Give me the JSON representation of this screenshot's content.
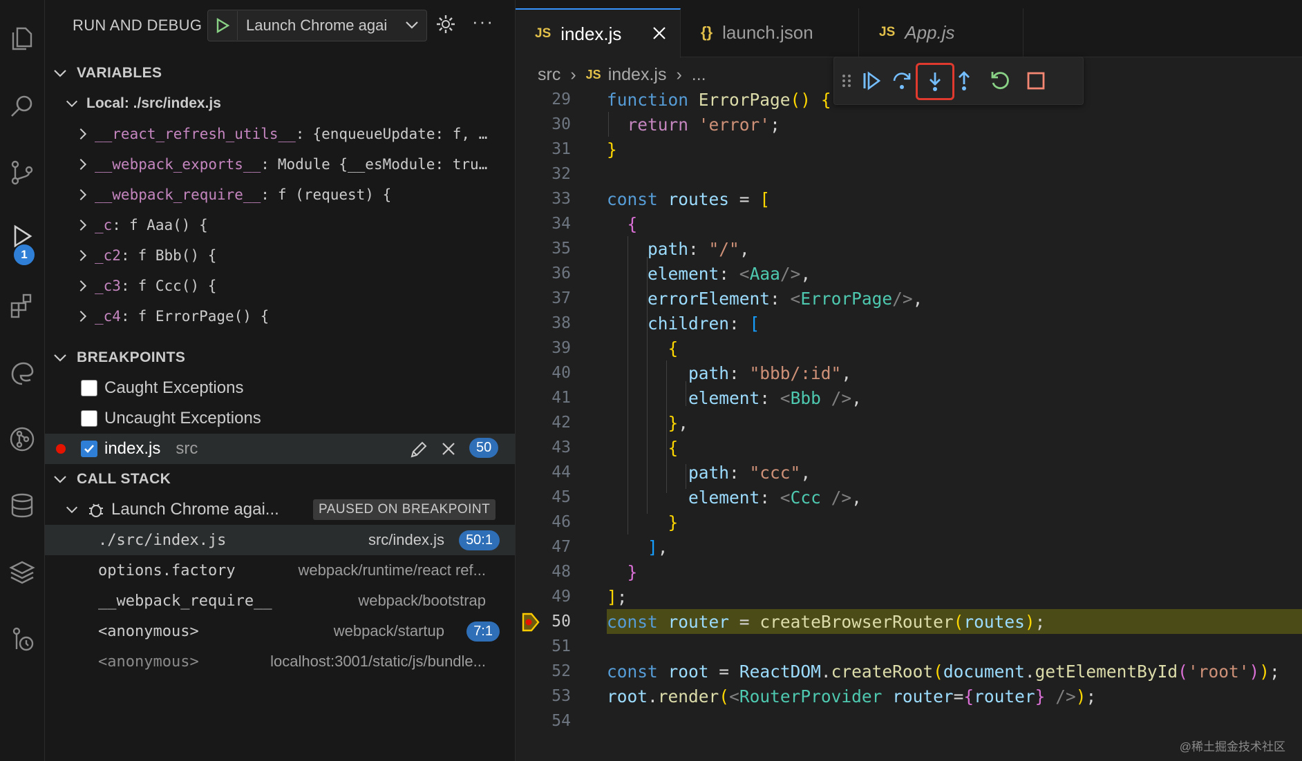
{
  "sidebar": {
    "title": "RUN AND DEBUG",
    "launch_config": "Launch Chrome agai",
    "sections": {
      "variables": "VARIABLES",
      "breakpoints": "BREAKPOINTS",
      "call_stack": "CALL STACK"
    },
    "local_scope": "Local: ./src/index.js",
    "variables": [
      {
        "name": "__react_refresh_utils__",
        "value": "{enqueueUpdate: f, …"
      },
      {
        "name": "__webpack_exports__",
        "value": "Module {__esModule: tru…"
      },
      {
        "name": "__webpack_require__",
        "value": "f (request) {"
      },
      {
        "name": "_c",
        "value": "f Aaa() {"
      },
      {
        "name": "_c2",
        "value": "f Bbb() {"
      },
      {
        "name": "_c3",
        "value": "f Ccc() {"
      },
      {
        "name": "_c4",
        "value": "f ErrorPage() {"
      }
    ],
    "breakpoints": {
      "caught": "Caught Exceptions",
      "uncaught": "Uncaught Exceptions",
      "file": "index.js",
      "folder": "src",
      "line": "50"
    },
    "call_stack": {
      "session": "Launch Chrome agai...",
      "status": "PAUSED ON BREAKPOINT",
      "frames": [
        {
          "name": "./src/index.js",
          "source": "src/index.js",
          "pos": "50:1"
        },
        {
          "name": "options.factory",
          "source": "webpack/runtime/react ref...",
          "pos": ""
        },
        {
          "name": "__webpack_require__",
          "source": "webpack/bootstrap",
          "pos": ""
        },
        {
          "name": "<anonymous>",
          "source": "webpack/startup",
          "pos": "7:1"
        },
        {
          "name": "<anonymous>",
          "source": "localhost:3001/static/js/bundle...",
          "pos": ""
        }
      ]
    }
  },
  "activity_badge": "1",
  "editor": {
    "tabs": [
      {
        "icon": "JS",
        "label": "index.js"
      },
      {
        "icon": "{}",
        "label": "launch.json"
      },
      {
        "icon": "JS",
        "label": "App.js"
      }
    ],
    "breadcrumb": {
      "folder": "src",
      "file": "index.js",
      "more": "..."
    },
    "line_numbers": [
      "29",
      "30",
      "31",
      "32",
      "33",
      "34",
      "35",
      "36",
      "37",
      "38",
      "39",
      "40",
      "41",
      "42",
      "43",
      "44",
      "45",
      "46",
      "47",
      "48",
      "49",
      "50",
      "51",
      "52",
      "53",
      "54"
    ],
    "current_line": "50"
  },
  "colors": {
    "accent": "#3794ff",
    "highlight_border": "#e03a2f",
    "current_line_bg": "#4b4b18",
    "badge": "#2f7fd6"
  },
  "watermark": "@稀土掘金技术社区"
}
